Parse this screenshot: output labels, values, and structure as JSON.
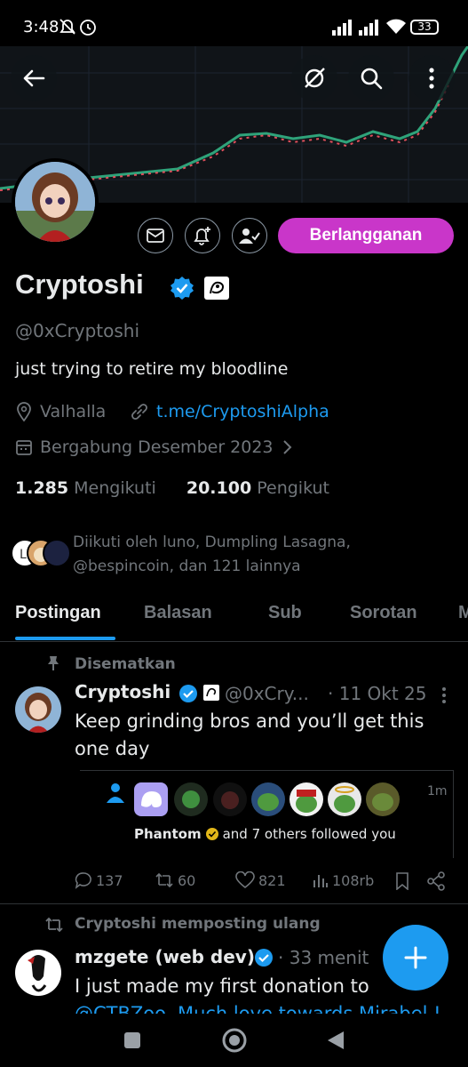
{
  "status_bar": {
    "time": "3:48",
    "battery": "33"
  },
  "profile": {
    "name": "Cryptoshi",
    "handle": "@0xCryptoshi",
    "bio": "just trying to retire my bloodline",
    "location": "Valhalla",
    "link": "t.me/CryptoshiAlpha",
    "joined": "Bergabung Desember 2023",
    "following_count": "1.285",
    "following_label": "Mengikuti",
    "followers_count": "20.100",
    "followers_label": "Pengikut",
    "followed_by": "Diikuti oleh luno, Dumpling Lasagna,",
    "followed_by_2": "@bespincoin, dan 121 lainnya",
    "subscribe_label": "Berlangganan"
  },
  "tabs": [
    "Postingan",
    "Balasan",
    "Sub",
    "Sorotan",
    "M"
  ],
  "pinned_tweet": {
    "pinned_label": "Disematkan",
    "author": "Cryptoshi",
    "handle": "@0xCry...",
    "date": "· 11 Okt 25",
    "text_line1": "Keep grinding bros and you’ll get this",
    "text_line2": "one day",
    "card": {
      "time": "1m",
      "follower_name": "Phantom",
      "follower_text": "and 7 others followed you"
    },
    "replies": "137",
    "retweets": "60",
    "likes": "821",
    "views": "108rb"
  },
  "retweet": {
    "label": "Cryptoshi memposting ulang",
    "author": "mzgete (web dev)",
    "time": "· 33 menit",
    "text_line1": "I just made my first donation to",
    "text_line2": "@CTBZoo. Much love towards Mirabel !"
  },
  "colors": {
    "accent": "#1d9bf0",
    "subscribe": "#c936c9",
    "verified": "#1d9bf0",
    "background": "#000000"
  }
}
